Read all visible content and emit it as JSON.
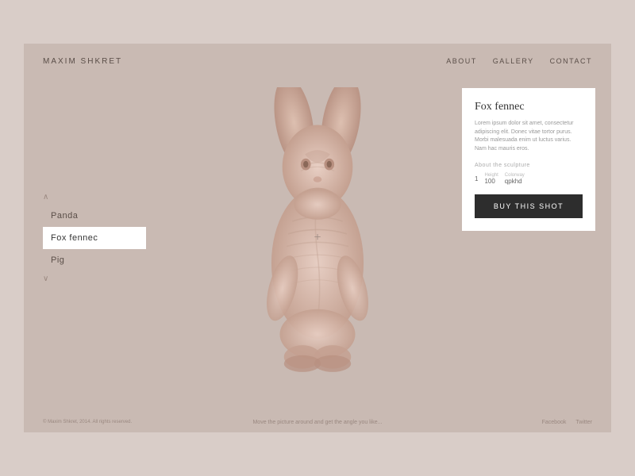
{
  "header": {
    "logo": "MAXIM SHKRET",
    "nav": [
      {
        "label": "ABOUT",
        "id": "about"
      },
      {
        "label": "GALLERY",
        "id": "gallery"
      },
      {
        "label": "CONTACT",
        "id": "contact"
      }
    ]
  },
  "sculpture_list": {
    "prev_arrow": "∧",
    "next_arrow": "∨",
    "items": [
      {
        "label": "Panda",
        "active": false
      },
      {
        "label": "Fox fennec",
        "active": true
      },
      {
        "label": "Pig",
        "active": false
      }
    ]
  },
  "info_panel": {
    "title": "Fox fennec",
    "description": "Lorem ipsum dolor sit amet, consectetur adipiscing elit. Donec vitae tortor purus. Morbi malesuada enim ut luctus varius. Nam hac mauris eros.",
    "details_label": "About the sculpture",
    "detail_items": [
      {
        "label": "1",
        "sub_label": ""
      },
      {
        "label": "Height",
        "value": "100"
      },
      {
        "label": "Colorway",
        "value": "qpkhd"
      }
    ],
    "buy_button": "BUY THIS SHOT"
  },
  "footer": {
    "copyright": "© Maxim Shkret, 2014. All rights reserved.",
    "hint": "Move the picture around and get the angle you like...",
    "social": [
      {
        "label": "Facebook"
      },
      {
        "label": "Twitter"
      }
    ]
  },
  "colors": {
    "background": "#d9cdc8",
    "card_bg": "#c9bab3",
    "white": "#ffffff",
    "dark": "#2d2d2d",
    "text_dark": "#5a4e48",
    "text_muted": "#9a8880"
  }
}
